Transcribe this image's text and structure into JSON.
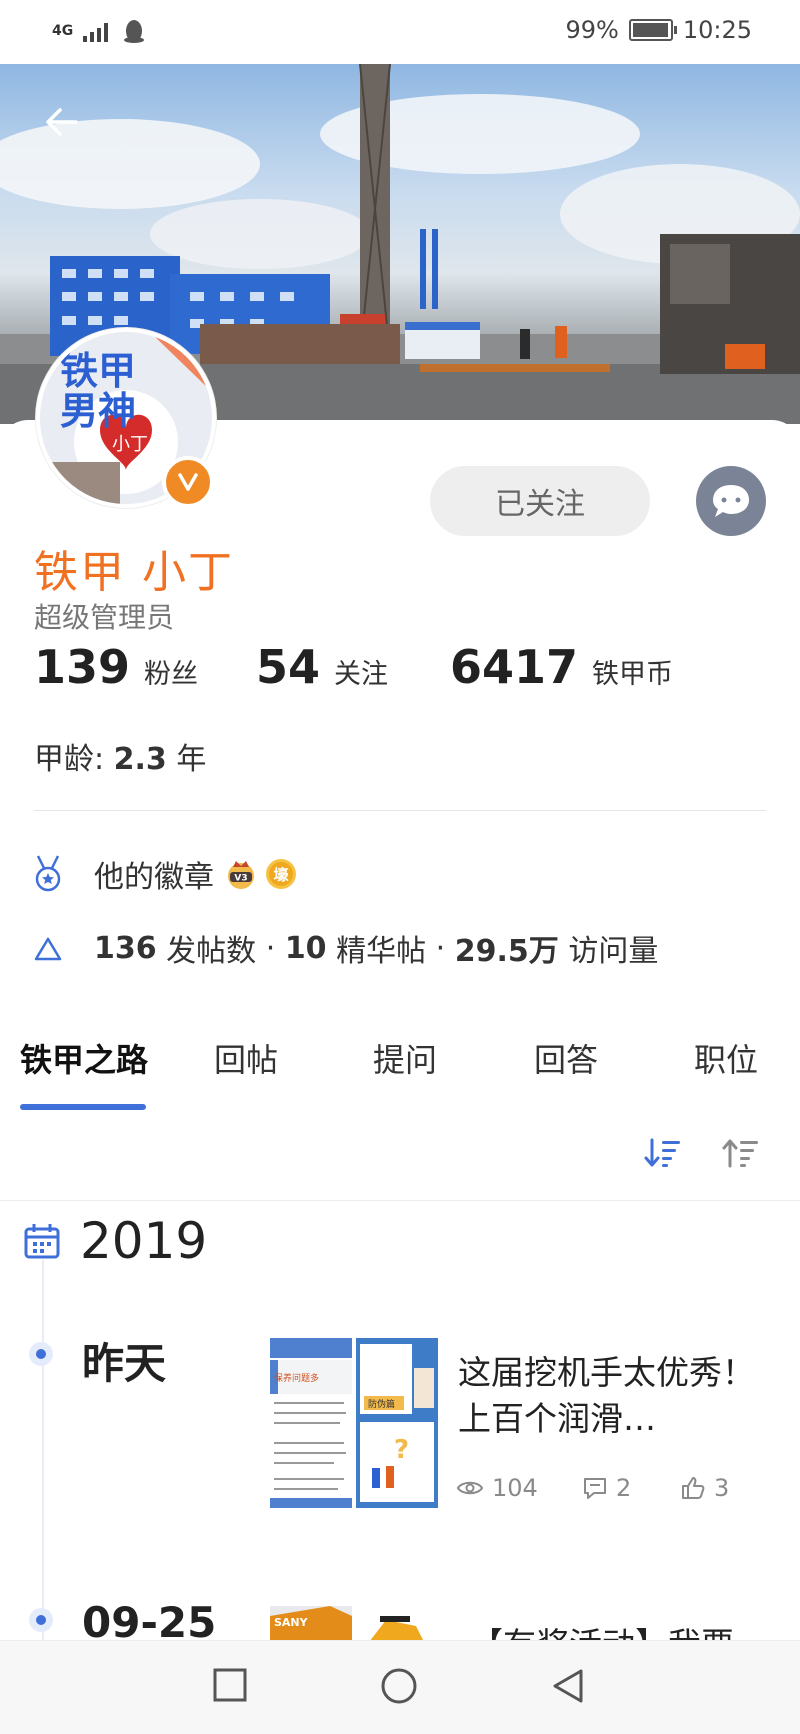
{
  "status_bar": {
    "network": "4G",
    "battery_text": "99%",
    "battery_level": 0.99,
    "time": "10:25"
  },
  "profile": {
    "name": "铁甲 小丁",
    "role": "超级管理员",
    "follow_button": "已关注",
    "avatar_text_1": "铁甲",
    "avatar_text_2": "男神",
    "avatar_text_3": "小丁",
    "verified_badge": "V",
    "stats": [
      {
        "value": "139",
        "label": "粉丝"
      },
      {
        "value": "54",
        "label": "关注"
      },
      {
        "value": "6417",
        "label": "铁甲币"
      }
    ],
    "age_label": "甲龄:",
    "age_value": "2.3",
    "age_unit": "年"
  },
  "badges": {
    "label": "他的徽章",
    "badge_1_text": "V3",
    "badge_2_text": "壕"
  },
  "post_stats": {
    "posts_value": "136",
    "posts_label": "发帖数",
    "sep": "·",
    "featured_value": "10",
    "featured_label": "精华帖",
    "visits_value": "29.5万",
    "visits_label": "访问量"
  },
  "tabs": [
    {
      "label": "铁甲之路",
      "active": true
    },
    {
      "label": "回帖",
      "active": false
    },
    {
      "label": "提问",
      "active": false
    },
    {
      "label": "回答",
      "active": false
    },
    {
      "label": "职位",
      "active": false
    }
  ],
  "timeline": {
    "year": "2019",
    "entries": [
      {
        "date": "昨天",
        "title": "这届挖机手太优秀！上百个润滑…",
        "thumb_text_1": "保养问题多",
        "thumb_text_2": "防伪篇",
        "views": "104",
        "comments": "2",
        "likes": "3"
      },
      {
        "date": "09-25",
        "title": "【有奖活动】我要",
        "thumb_text_1": "SANY"
      }
    ]
  },
  "colors": {
    "accent": "#3f6fd8",
    "name": "#f07122",
    "badge": "#f08a24"
  }
}
